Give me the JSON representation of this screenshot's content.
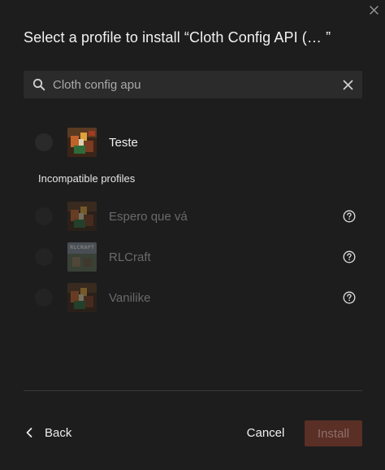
{
  "dialog": {
    "title": "Select a profile to install “Cloth Config API (…  ”",
    "close_icon": "close-icon"
  },
  "search": {
    "value": "Cloth config apu",
    "placeholder": "",
    "icon": "search-icon",
    "clear_icon": "close-icon"
  },
  "profiles": [
    {
      "name": "Teste",
      "selected": false,
      "disabled": false,
      "thumb": "minecraft-profile-art"
    }
  ],
  "incompatible": {
    "heading": "Incompatible profiles",
    "items": [
      {
        "name": "Espero que vá",
        "disabled": true,
        "thumb": "minecraft-profile-art",
        "help_icon": "help-circle-icon"
      },
      {
        "name": "RLCraft",
        "disabled": true,
        "thumb": "rlcraft-logo",
        "help_icon": "help-circle-icon",
        "thumb_text": "RLCRAFT"
      },
      {
        "name": "Vanilike",
        "disabled": true,
        "thumb": "minecraft-profile-art",
        "help_icon": "help-circle-icon"
      }
    ]
  },
  "footer": {
    "back_label": "Back",
    "cancel_label": "Cancel",
    "install_label": "Install",
    "back_icon": "chevron-left-icon"
  },
  "colors": {
    "background": "#1d1d1d",
    "input_bg": "#2b2b2b",
    "install_disabled_bg": "#5a2f26",
    "install_disabled_text": "#8e6f69",
    "disabled_text": "#6a6a6a"
  }
}
